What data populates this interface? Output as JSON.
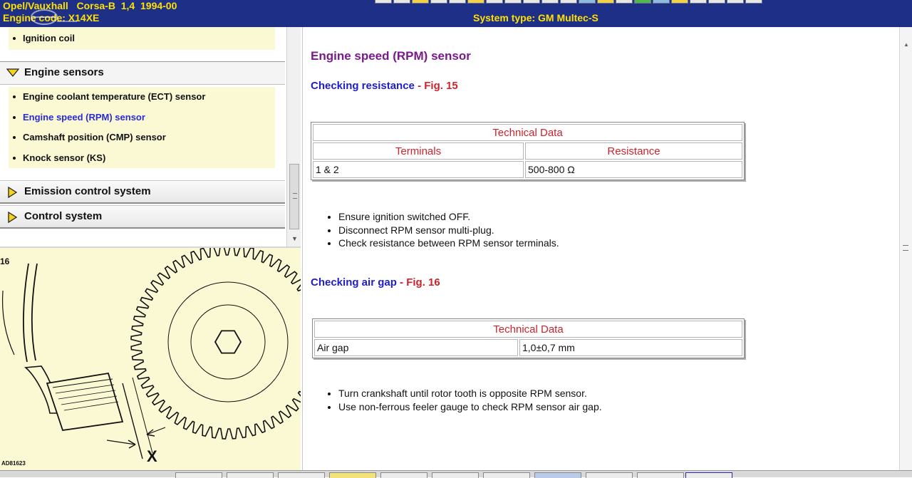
{
  "header": {
    "make": "Opel/Vauxhall",
    "model": "Corsa-B",
    "engine_size": "1,4",
    "years": "1994-00",
    "engine_code_label": "Engine code:",
    "engine_code": "X14XE",
    "system_type_label": "System type:",
    "system_type": "GM Multec-S",
    "colors": {
      "background": "#1d2f87",
      "text": "#ffe000"
    }
  },
  "nav": {
    "top_items": [
      "Ignition coil"
    ],
    "sections": [
      {
        "label": "Engine sensors",
        "expanded": true,
        "icon": "arrow-down-diamond-icon",
        "items": [
          {
            "label": "Engine coolant temperature (ECT) sensor",
            "active": false
          },
          {
            "label": "Engine speed (RPM) sensor",
            "active": true
          },
          {
            "label": "Camshaft position (CMP) sensor",
            "active": false
          },
          {
            "label": "Knock sensor (KS)",
            "active": false
          }
        ]
      },
      {
        "label": "Emission control system",
        "expanded": false,
        "icon": "arrow-right-diamond-icon"
      },
      {
        "label": "Control system",
        "expanded": false,
        "icon": "arrow-right-diamond-icon"
      }
    ],
    "colors": {
      "active_item": "#2a2ad8",
      "list_background": "#fbf9d4"
    }
  },
  "figure": {
    "number": "16",
    "callout": "X",
    "drawing_code": "AD81623"
  },
  "content": {
    "title": "Engine speed (RPM) sensor",
    "sections": [
      {
        "heading": "Checking resistance",
        "separator": "-",
        "fig_ref": "Fig. 15",
        "table": {
          "title": "Technical Data",
          "headers": [
            "Terminals",
            "Resistance"
          ],
          "rows": [
            [
              "1 & 2",
              "500-800 Ω"
            ]
          ]
        },
        "bullets": [
          "Ensure ignition switched OFF.",
          "Disconnect RPM sensor multi-plug.",
          "Check resistance between RPM sensor terminals."
        ]
      },
      {
        "heading": "Checking air gap",
        "separator": "-",
        "fig_ref": "Fig. 16",
        "table": {
          "title": "Technical Data",
          "rows": [
            [
              "Air gap",
              "1,0±0,7 mm"
            ]
          ]
        },
        "bullets": [
          "Turn crankshaft until rotor tooth is opposite RPM sensor.",
          "Use non-ferrous feeler gauge to check RPM sensor air gap."
        ]
      }
    ],
    "colors": {
      "title": "#7a1a8c",
      "heading": "#1d1dcf",
      "table_header": "#d0222c"
    }
  }
}
